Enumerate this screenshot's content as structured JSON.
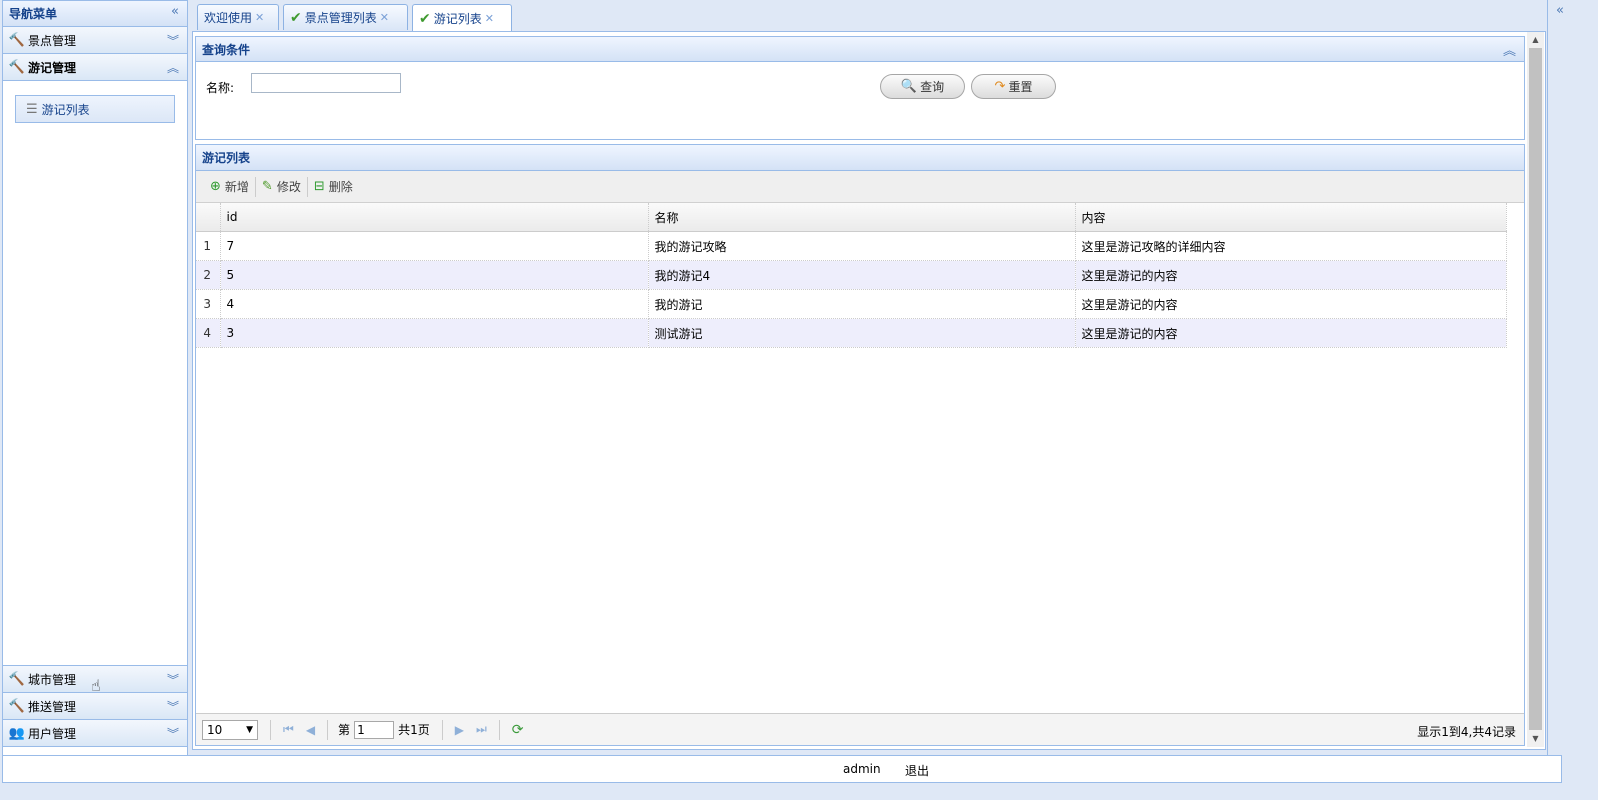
{
  "nav": {
    "title": "导航菜单",
    "collapse_glyph": "«",
    "sections": [
      {
        "label": "景点管理",
        "icon": "hammer-icon",
        "open": false
      },
      {
        "label": "游记管理",
        "icon": "hammer-icon",
        "open": true,
        "items": [
          {
            "label": "游记列表",
            "icon": "list-icon"
          }
        ]
      },
      {
        "label": "城市管理",
        "icon": "hammer-icon",
        "open": false
      },
      {
        "label": "推送管理",
        "icon": "hammer-icon",
        "open": false
      },
      {
        "label": "用户管理",
        "icon": "users-icon",
        "open": false
      }
    ]
  },
  "tabs": [
    {
      "label": "欢迎使用",
      "active": false,
      "has_check": false
    },
    {
      "label": "景点管理列表",
      "active": false,
      "has_check": true
    },
    {
      "label": "游记列表",
      "active": true,
      "has_check": true
    }
  ],
  "query": {
    "title": "查询条件",
    "name_label": "名称:",
    "name_value": "",
    "search_label": "查询",
    "reset_label": "重置"
  },
  "grid": {
    "title": "游记列表",
    "toolbar": {
      "add": "新增",
      "edit": "修改",
      "delete": "删除"
    },
    "columns": [
      "id",
      "名称",
      "内容"
    ],
    "rows": [
      {
        "rn": "1",
        "id": "7",
        "name": "我的游记攻略",
        "content": "这里是游记攻略的详细内容"
      },
      {
        "rn": "2",
        "id": "5",
        "name": "我的游记4",
        "content": "这里是游记的内容"
      },
      {
        "rn": "3",
        "id": "4",
        "name": "我的游记",
        "content": "这里是游记的内容"
      },
      {
        "rn": "4",
        "id": "3",
        "name": "测试游记",
        "content": "这里是游记的内容"
      }
    ],
    "pager": {
      "page_size": "10",
      "page_prefix": "第",
      "page_value": "1",
      "page_total": "共1页",
      "info": "显示1到4,共4记录"
    }
  },
  "status": {
    "user": "admin",
    "logout": "退出"
  },
  "colors": {
    "header_text": "#15428b",
    "border": "#99bbe8",
    "alt_row": "#eeeefc",
    "check_green": "#3f9a2f"
  }
}
